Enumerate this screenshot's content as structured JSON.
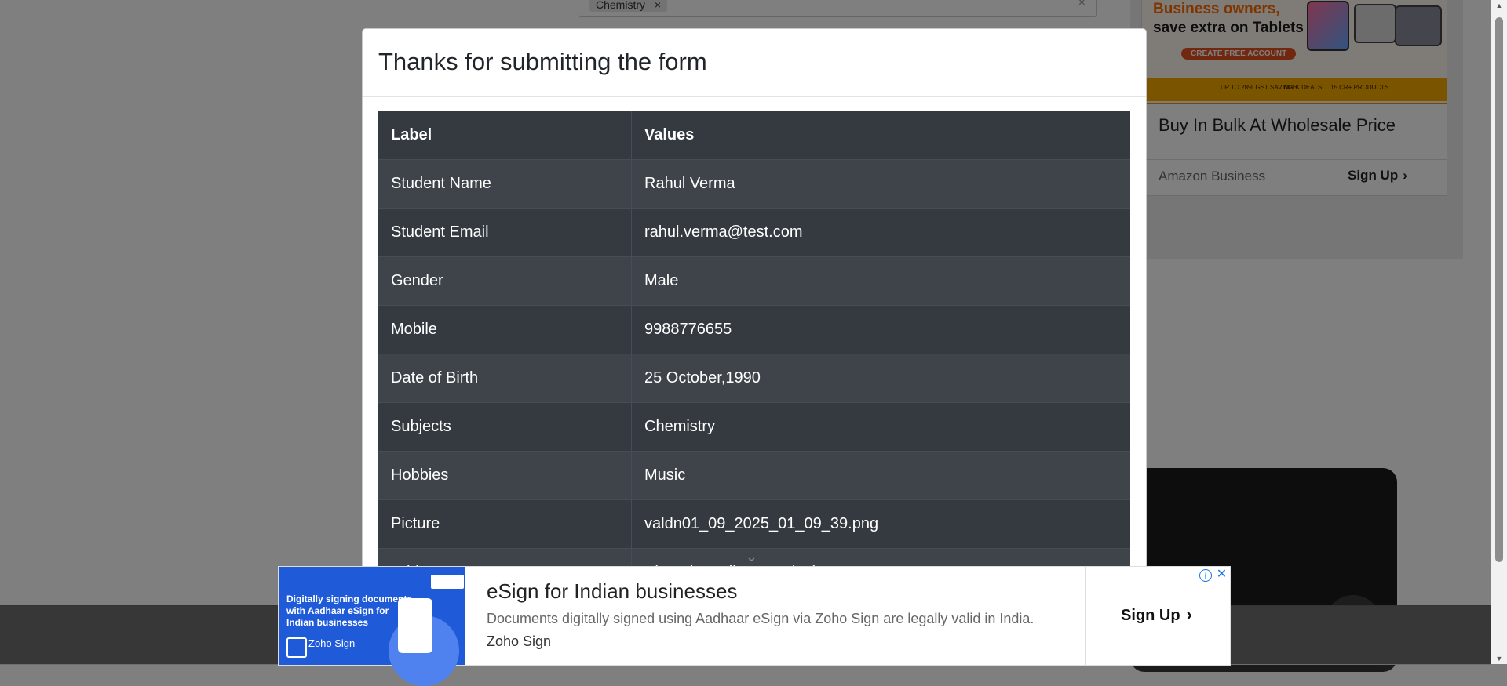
{
  "background": {
    "subject_chip": "Chemistry",
    "chip_remove": "×",
    "clear_icon": "×"
  },
  "right_ad": {
    "banner_line1": "Business owners,",
    "banner_line2": "save extra on Tablets",
    "banner_button": "CREATE FREE ACCOUNT",
    "strip_1": "UP TO 28% GST SAVINGS",
    "strip_2": "BULK DEALS",
    "strip_3": "15 CR+ PRODUCTS",
    "headline": "Buy In Bulk At Wholesale Price",
    "brand": "Amazon Business",
    "cta": "Sign Up",
    "cta_icon": "›"
  },
  "modal": {
    "title": "Thanks for submitting the form",
    "table": {
      "headers": [
        "Label",
        "Values"
      ],
      "rows": [
        {
          "label": "Student Name",
          "value": "Rahul Verma"
        },
        {
          "label": "Student Email",
          "value": "rahul.verma@test.com"
        },
        {
          "label": "Gender",
          "value": "Male"
        },
        {
          "label": "Mobile",
          "value": "9988776655"
        },
        {
          "label": "Date of Birth",
          "value": "25 October,1990"
        },
        {
          "label": "Subjects",
          "value": "Chemistry"
        },
        {
          "label": "Hobbies",
          "value": "Music"
        },
        {
          "label": "Picture",
          "value": "valdn01_09_2025_01_09_39.png"
        },
        {
          "label": "Address",
          "value": "Bhopal, Madhya Pradesh"
        }
      ]
    }
  },
  "bottom_ad": {
    "image_text": "Digitally signing documents with Aadhaar eSign for Indian businesses",
    "image_logo": "Zoho Sign",
    "title": "eSign for Indian businesses",
    "description": "Documents digitally signed using Aadhaar eSign via Zoho Sign are legally valid in India.",
    "brand": "Zoho Sign",
    "cta": "Sign Up",
    "cta_icon": "›",
    "info_icon": "i",
    "close_icon": "✕"
  }
}
